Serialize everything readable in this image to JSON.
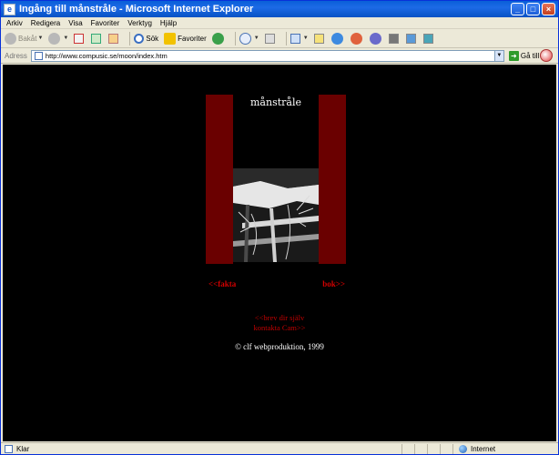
{
  "window": {
    "title": "Ingång till månstråle - Microsoft Internet Explorer",
    "controls": {
      "minimize": "_",
      "maximize": "□",
      "close": "×"
    }
  },
  "menu": {
    "items": [
      "Arkiv",
      "Redigera",
      "Visa",
      "Favoriter",
      "Verktyg",
      "Hjälp"
    ]
  },
  "toolbar": {
    "back_label": "Bakåt",
    "search_label": "Sök",
    "favorites_label": "Favoriter"
  },
  "address": {
    "label": "Adress",
    "url": "http://www.compusic.se/moon/index.htm",
    "go_label": "Gå till"
  },
  "page": {
    "title": "månstråle",
    "nav_left": "<<fakta",
    "nav_right": "bok>>",
    "link_mail": "<<brev dir själv",
    "link_contact": "kontakta Cam>>",
    "copyright": "© clf webproduktion, 1999"
  },
  "status": {
    "text": "Klar",
    "zone": "Internet"
  },
  "colors": {
    "page_background": "#000000",
    "panel_red": "#6a0000",
    "link_red": "#d00000",
    "title_bar_blue": "#0a5fd8"
  }
}
